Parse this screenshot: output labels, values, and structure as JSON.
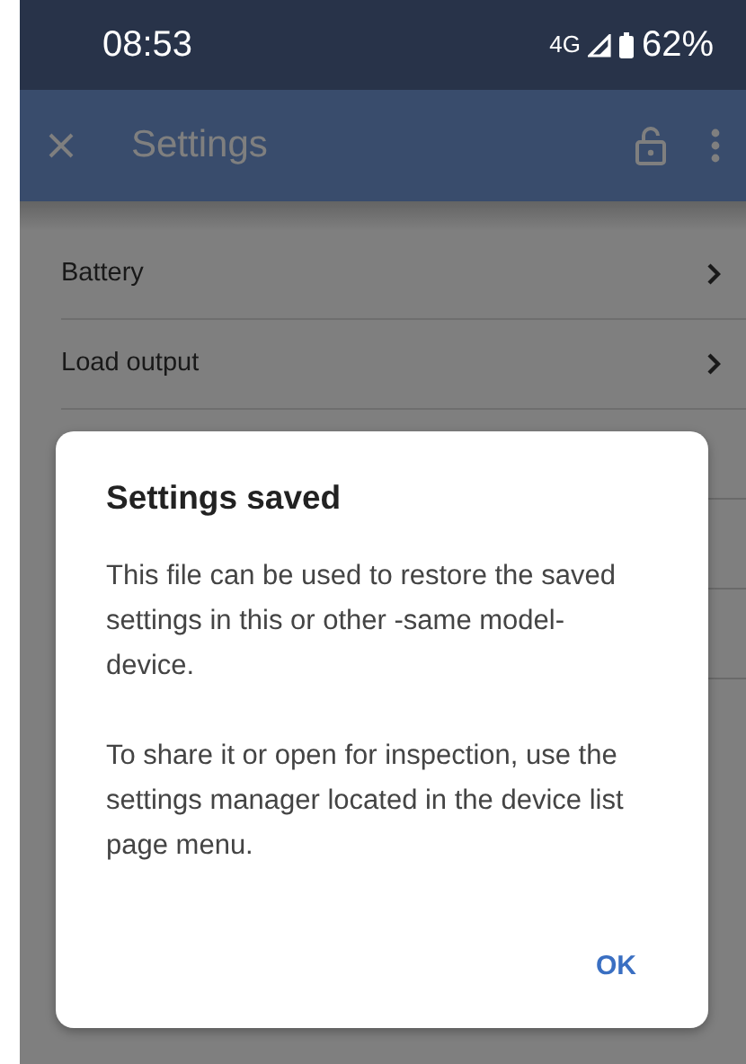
{
  "status_bar": {
    "time": "08:53",
    "network": "4G",
    "battery": "62%"
  },
  "app_bar": {
    "title": "Settings"
  },
  "settings_list": [
    {
      "label": "Battery"
    },
    {
      "label": "Load output"
    }
  ],
  "dialog": {
    "title": "Settings saved",
    "paragraphs": [
      "This file can be used to restore the saved settings in this or other -same model- device.",
      "To share it or open for inspection, use the settings manager located in the device list page menu."
    ],
    "button": "OK"
  }
}
